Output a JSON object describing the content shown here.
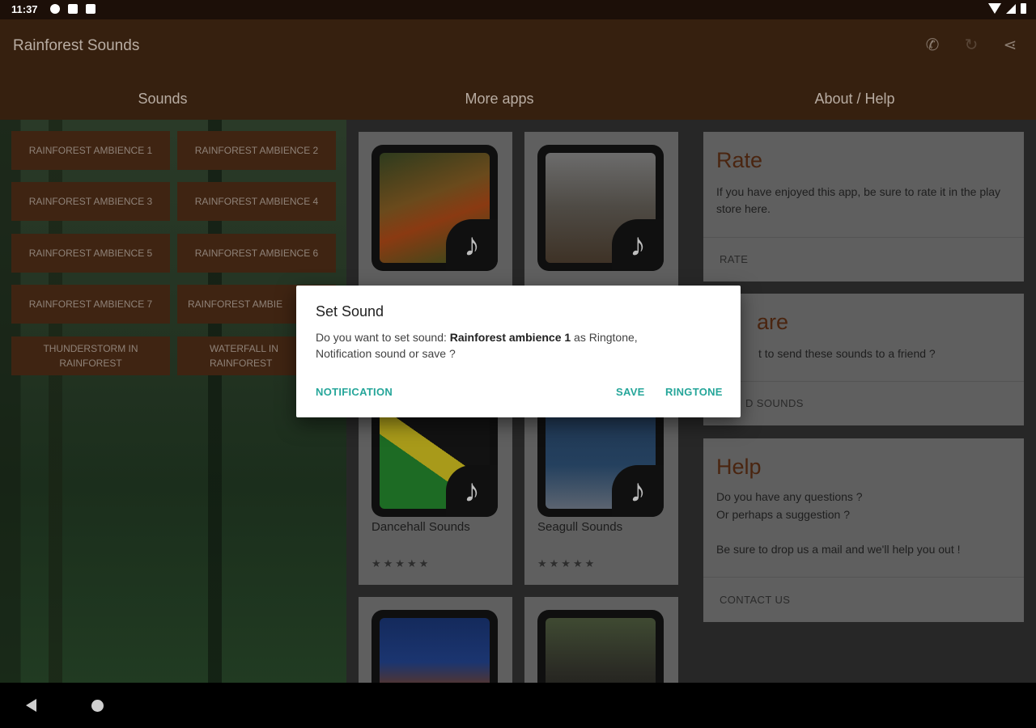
{
  "status_bar": {
    "time": "11:37"
  },
  "app_bar": {
    "title": "Rainforest Sounds",
    "tabs": [
      "Sounds",
      "More apps",
      "About / Help"
    ]
  },
  "sound_buttons": [
    "RAINFOREST AMBIENCE 1",
    "RAINFOREST AMBIENCE 2",
    "RAINFOREST AMBIENCE 3",
    "RAINFOREST AMBIENCE 4",
    "RAINFOREST AMBIENCE 5",
    "RAINFOREST AMBIENCE 6",
    "RAINFOREST AMBIENCE 7",
    "RAINFOREST AMBIE",
    "THUNDERSTORM IN RAINFOREST",
    "WATERFALL IN RAINFOREST"
  ],
  "app_cards": [
    {
      "title": "",
      "stars": "",
      "image": "rooster"
    },
    {
      "title": "",
      "stars": "",
      "image": "deer"
    },
    {
      "title": "Dancehall Sounds",
      "stars": "★★★★★",
      "image": "jamaica-flag"
    },
    {
      "title": "Seagull Sounds",
      "stars": "★★★★★",
      "image": "seagull"
    },
    {
      "title": "",
      "stars": "",
      "image": "horse"
    },
    {
      "title": "",
      "stars": "",
      "image": "buffalo"
    }
  ],
  "info_cards": {
    "rate": {
      "title": "Rate",
      "text": "If you have enjoyed this app, be sure to rate it in the play store here.",
      "action": "RATE"
    },
    "share": {
      "title": "are",
      "text": "t to send these sounds to a friend ?",
      "action": "D SOUNDS"
    },
    "help": {
      "title": "Help",
      "line1": "Do you have any questions ?",
      "line2": "Or perhaps a suggestion ?",
      "line3": "Be sure to drop us a mail and we'll help you out !",
      "action": "CONTACT US"
    }
  },
  "dialog": {
    "title": "Set Sound",
    "msg_before": "Do you want to set sound: ",
    "msg_bold": "Rainforest ambience 1",
    "msg_after": " as Ringtone,",
    "msg_line2": "Notification sound or save ?",
    "btn_notification": "NOTIFICATION",
    "btn_save": "SAVE",
    "btn_ringtone": "RINGTONE",
    "accent": "#26a69a"
  }
}
